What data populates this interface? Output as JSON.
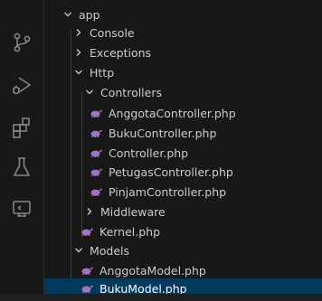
{
  "colors": {
    "background": "#181818",
    "selection": "#04395e",
    "php_icon": "#a074c4",
    "text": "#cccccc"
  },
  "activity_bar": {
    "icons": [
      "source-control-icon",
      "run-debug-icon",
      "extensions-icon",
      "testing-icon",
      "remote-explorer-icon"
    ]
  },
  "tree": [
    {
      "label": "app",
      "kind": "folder",
      "expanded": true,
      "depth": 0
    },
    {
      "label": "Console",
      "kind": "folder",
      "expanded": false,
      "depth": 1
    },
    {
      "label": "Exceptions",
      "kind": "folder",
      "expanded": false,
      "depth": 1
    },
    {
      "label": "Http",
      "kind": "folder",
      "expanded": true,
      "depth": 1
    },
    {
      "label": "Controllers",
      "kind": "folder",
      "expanded": true,
      "depth": 2
    },
    {
      "label": "AnggotaController.php",
      "kind": "php",
      "depth": 3
    },
    {
      "label": "BukuController.php",
      "kind": "php",
      "depth": 3
    },
    {
      "label": "Controller.php",
      "kind": "php",
      "depth": 3
    },
    {
      "label": "PetugasController.php",
      "kind": "php",
      "depth": 3
    },
    {
      "label": "PinjamController.php",
      "kind": "php",
      "depth": 3
    },
    {
      "label": "Middleware",
      "kind": "folder",
      "expanded": false,
      "depth": 2
    },
    {
      "label": "Kernel.php",
      "kind": "php",
      "depth": 2
    },
    {
      "label": "Models",
      "kind": "folder",
      "expanded": true,
      "depth": 1
    },
    {
      "label": "AnggotaModel.php",
      "kind": "php",
      "depth": 2
    },
    {
      "label": "BukuModel.php",
      "kind": "php",
      "depth": 2,
      "selected": true
    }
  ]
}
